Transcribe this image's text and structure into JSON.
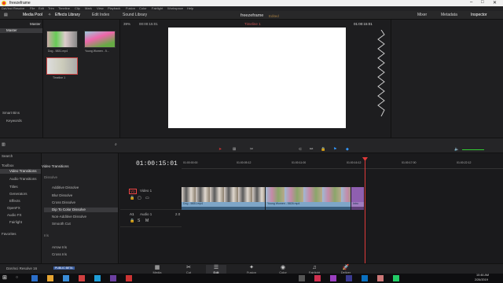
{
  "window": {
    "title": "freezeframe",
    "controls": [
      "–",
      "□",
      "✕"
    ]
  },
  "menu": [
    "DaVinci Resolve",
    "File",
    "Edit",
    "Trim",
    "Timeline",
    "Clip",
    "Mark",
    "View",
    "Playback",
    "Fusion",
    "Color",
    "Fairlight",
    "Workspace",
    "Help"
  ],
  "toolbar": {
    "media_pool": "Media Pool",
    "effects_library": "Effects Library",
    "edit_index": "Edit Index",
    "sound_library": "Sound Library",
    "project": "freezeframe",
    "edited": "Edited",
    "mixer": "Mixer",
    "metadata": "Metadata",
    "inspector": "Inspector"
  },
  "media": {
    "bin_label": "Master",
    "bin_title": "Master",
    "clips": [
      {
        "name": "Dog - 5831.mp4"
      },
      {
        "name": "Young Women - 5..."
      },
      {
        "name": "Timeline 1"
      }
    ],
    "smart_bins": "Smart Bins",
    "keywords": "Keywords"
  },
  "viewer": {
    "zoom": "39%",
    "source_tc": "00:00:15:01",
    "timeline_name": "Timeline 1",
    "record_tc": "01:00:15:01",
    "page_dots": "•  2  •"
  },
  "effects": {
    "toolbox": "Toolbox",
    "items": [
      "Video Transitions",
      "Audio Transitions",
      "Titles",
      "Generators",
      "Effects",
      "OpenFX",
      "Audio FX",
      "Fairlight"
    ],
    "favorites": "Favorites",
    "search": "Search",
    "group_title": "Video Transitions",
    "group": "Dissolve",
    "transitions": [
      "Additive Dissolve",
      "Blur Dissolve",
      "Cross Dissolve",
      "Dip To Color Dissolve",
      "Non-Additive Dissolve",
      "Smooth Cut"
    ],
    "iris": "Iris",
    "iris_items": [
      "Arrow Iris",
      "Cross Iris"
    ]
  },
  "timeline": {
    "timecode": "01:00:15:01",
    "ruler": [
      "01:00:00:00",
      "01:00:05:12",
      "01:00:11:00",
      "01:00:16:12",
      "01:00:17:00",
      "01:00:22:12"
    ],
    "video_track": {
      "id": "V1",
      "name": "Video 1"
    },
    "audio_track": {
      "id": "A1",
      "name": "Audio 1",
      "level": "2.0"
    },
    "clips": [
      "Dog - 5831.mp4",
      "Young Women - 5826.mp4",
      "Intro"
    ]
  },
  "pages": [
    "Media",
    "Cut",
    "Edit",
    "Fusion",
    "Color",
    "Fairlight",
    "Deliver"
  ],
  "active_page": "Edit",
  "brand": {
    "name": "DaVinci Resolve 16",
    "badge": "PUBLIC BETA"
  },
  "taskbar": {
    "time": "10:46 AM",
    "date": "2/26/2019"
  }
}
